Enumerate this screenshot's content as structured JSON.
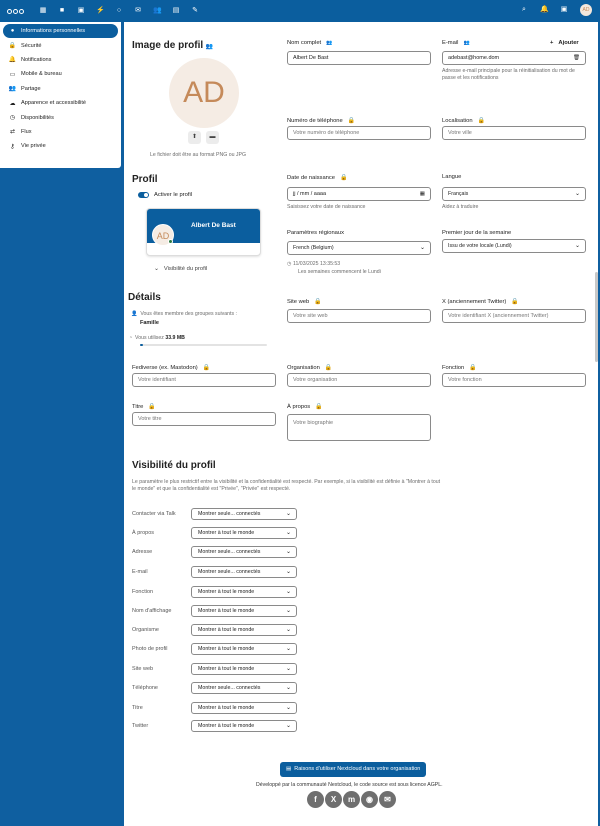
{
  "topbar": {
    "apps": [
      {
        "icon": "dashboard-icon",
        "glyph": "▦"
      },
      {
        "icon": "files-icon",
        "glyph": "■"
      },
      {
        "icon": "photos-icon",
        "glyph": "▣"
      },
      {
        "icon": "activity-icon",
        "glyph": "⚡"
      },
      {
        "icon": "search-app-icon",
        "glyph": "○"
      },
      {
        "icon": "mail-icon",
        "glyph": "✉"
      },
      {
        "icon": "contacts-icon",
        "glyph": "👥"
      },
      {
        "icon": "calendar-icon",
        "glyph": "▤"
      },
      {
        "icon": "notes-icon",
        "glyph": "✎"
      }
    ],
    "avatar_initials": "AD"
  },
  "sidebar": {
    "items": [
      {
        "label": "Informations personnelles",
        "icon": "user-icon",
        "glyph": "●",
        "active": true
      },
      {
        "label": "Sécurité",
        "icon": "lock-icon",
        "glyph": "🔒",
        "active": false
      },
      {
        "label": "Notifications",
        "icon": "bell-icon",
        "glyph": "🔔",
        "active": false
      },
      {
        "label": "Mobile & bureau",
        "icon": "monitor-icon",
        "glyph": "▭",
        "active": false
      },
      {
        "label": "Partage",
        "icon": "share-icon",
        "glyph": "👥",
        "active": false
      },
      {
        "label": "Apparence et accessibilité",
        "icon": "palette-icon",
        "glyph": "☁",
        "active": false
      },
      {
        "label": "Disponibilités",
        "icon": "clock-icon",
        "glyph": "◷",
        "active": false
      },
      {
        "label": "Flux",
        "icon": "flow-icon",
        "glyph": "⇄",
        "active": false
      },
      {
        "label": "Vie privée",
        "icon": "key-icon",
        "glyph": "⚷",
        "active": false
      }
    ]
  },
  "profile_picture": {
    "title": "Image de profil",
    "initials": "AD",
    "hint": "Le fichier doit être au format PNG ou JPG"
  },
  "fields": {
    "full_name": {
      "label": "Nom complet",
      "value": "Albert De Bast"
    },
    "email": {
      "label": "E-mail",
      "value": "adebast@home.dom",
      "add_label": "Ajouter",
      "hint": "Adresse e-mail principale pour la réinitialisation du mot de passe et les notifications"
    },
    "phone": {
      "label": "Numéro de téléphone",
      "placeholder": "Votre numéro de téléphone"
    },
    "location": {
      "label": "Localisation",
      "placeholder": "Votre ville"
    },
    "birthdate": {
      "label": "Date de naissance",
      "placeholder": "jj / mm / aaaa",
      "hint": "Saisissez votre date de naissance"
    },
    "language": {
      "label": "Langue",
      "value": "Français",
      "hint": "Aidez à traduire"
    },
    "locale": {
      "label": "Paramètres régionaux",
      "value": "French (Belgium)",
      "datetime": "11/03/2025 13:35:53",
      "week_hint": "Les semaines commencent le Lundi"
    },
    "first_day": {
      "label": "Premier jour de la semaine",
      "value": "Issu de votre locale (Lundi)"
    },
    "website": {
      "label": "Site web",
      "placeholder": "Votre site web"
    },
    "twitter": {
      "label": "X (anciennement Twitter)",
      "placeholder": "Votre identifiant X (anciennement Twitter)"
    },
    "fediverse": {
      "label": "Fediverse (ex. Mastodon)",
      "placeholder": "Votre identifiant"
    },
    "organisation": {
      "label": "Organisation",
      "placeholder": "Votre organisation"
    },
    "role": {
      "label": "Fonction",
      "placeholder": "Votre fonction"
    },
    "headline": {
      "label": "Titre",
      "placeholder": "Votre titre"
    },
    "about": {
      "label": "À propos",
      "placeholder": "Votre biographie"
    }
  },
  "profile": {
    "title": "Profil",
    "enable_label": "Activer le profil",
    "card_name": "Albert De Bast",
    "card_initials": "AD",
    "visibility_link": "Visibilité du profil"
  },
  "details": {
    "title": "Détails",
    "groups_text": "Vous êtes membre des groupes suivants :",
    "group": "Famille",
    "usage_prefix": "Vous utilisez",
    "usage_value": "33.9 MB",
    "usage_fraction": 0.02
  },
  "visibility": {
    "title": "Visibilité du profil",
    "description": "Le paramètre le plus restrictif entre la visibilité et la confidentialité est respecté. Par exemple, si la visibilité est définie à \"Montrer à tout le monde\" et que la confidentialité est \"Privée\", \"Privée\" est respecté.",
    "rows": [
      {
        "label": "Contacter via Talk",
        "value": "Montrer seule... connectés"
      },
      {
        "label": "À propos",
        "value": "Montrer à tout le monde"
      },
      {
        "label": "Adresse",
        "value": "Montrer seule... connectés"
      },
      {
        "label": "E-mail",
        "value": "Montrer seule... connectés"
      },
      {
        "label": "Fonction",
        "value": "Montrer à tout le monde"
      },
      {
        "label": "Nom d'affichage",
        "value": "Montrer à tout le monde"
      },
      {
        "label": "Organisme",
        "value": "Montrer à tout le monde"
      },
      {
        "label": "Photo de profil",
        "value": "Montrer à tout le monde"
      },
      {
        "label": "Site web",
        "value": "Montrer à tout le monde"
      },
      {
        "label": "Téléphone",
        "value": "Montrer seule... connectés"
      },
      {
        "label": "Titre",
        "value": "Montrer à tout le monde"
      },
      {
        "label": "Twitter",
        "value": "Montrer à tout le monde"
      }
    ]
  },
  "footer": {
    "button": "Raisons d'utiliser Nextcloud dans votre organisation",
    "text": "Développé par la communauté Nextcloud, le code source est sous licence AGPL.",
    "socials": [
      {
        "icon": "facebook-icon",
        "glyph": "f"
      },
      {
        "icon": "x-icon",
        "glyph": "X"
      },
      {
        "icon": "mastodon-icon",
        "glyph": "m"
      },
      {
        "icon": "rss-icon",
        "glyph": "◉"
      },
      {
        "icon": "mail-icon",
        "glyph": "✉"
      }
    ]
  },
  "colors": {
    "primary": "#0b5e9e",
    "avatar_bg": "#f5ece4",
    "avatar_text": "#c58a5a",
    "online": "#2d7b41"
  }
}
